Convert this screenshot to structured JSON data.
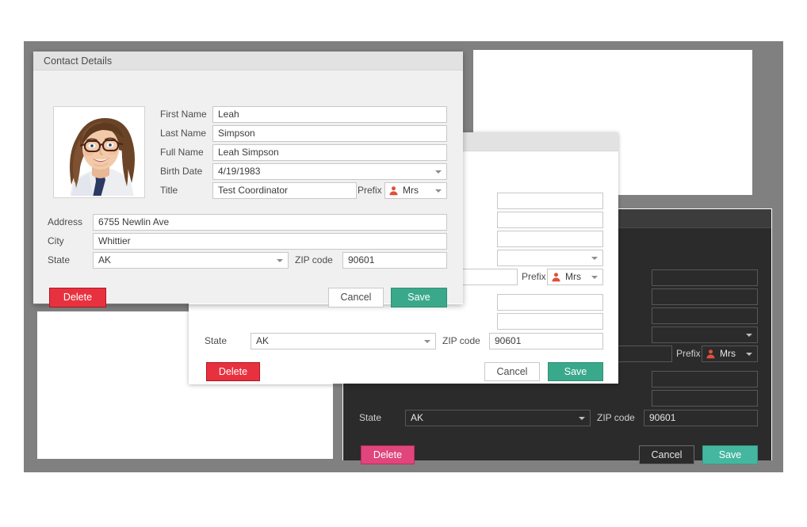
{
  "canvas": {
    "background": "#ffffff",
    "backdrop_color": "#808080"
  },
  "palette": {
    "delete_light": "#e8313f",
    "delete_dark": "#e0457b",
    "save_light": "#3aa98b",
    "save_dark": "#45b6a0",
    "prefix_icon": "#e0503a",
    "title_bar_light": "#e2e2e2",
    "title_bar_dark": "#3c3c3c",
    "body_light": "#f0f0f0",
    "body_dark": "#2b2b2b"
  },
  "contact": {
    "first_name_label": "First Name",
    "first_name_value": "Leah",
    "last_name_label": "Last Name",
    "last_name_value": "Simpson",
    "full_name_label": "Full Name",
    "full_name_value": "Leah Simpson",
    "birth_date_label": "Birth Date",
    "birth_date_value": "4/19/1983",
    "title_label": "Title",
    "title_value": "Test Coordinator",
    "prefix_label": "Prefix",
    "prefix_value": "Mrs",
    "address_label": "Address",
    "address_value": "6755 Newlin Ave",
    "city_label": "City",
    "city_value": "Whittier",
    "state_label": "State",
    "state_value": "AK",
    "zip_label": "ZIP code",
    "zip_value": "90601"
  },
  "buttons": {
    "delete": "Delete",
    "cancel": "Cancel",
    "save": "Save"
  },
  "dialogs": [
    {
      "id": "front",
      "title": "Contact Details",
      "theme": "light"
    },
    {
      "id": "middle",
      "title": "",
      "theme": "light"
    },
    {
      "id": "back",
      "title": "",
      "theme": "dark"
    }
  ],
  "icons": {
    "prefix": "person-icon",
    "dropdown": "chevron-down-icon"
  }
}
